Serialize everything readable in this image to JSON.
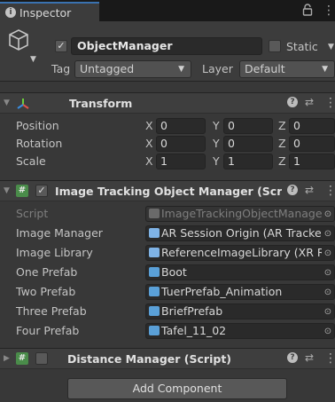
{
  "tab": {
    "title": "Inspector",
    "icon": "info-icon"
  },
  "object": {
    "name": "ObjectManager",
    "active_checked": true,
    "static_label": "Static",
    "static_checked": false,
    "tag_label": "Tag",
    "tag_value": "Untagged",
    "layer_label": "Layer",
    "layer_value": "Default"
  },
  "transform": {
    "title": "Transform",
    "rows": [
      {
        "label": "Position",
        "x": "0",
        "y": "0",
        "z": "0"
      },
      {
        "label": "Rotation",
        "x": "0",
        "y": "0",
        "z": "0"
      },
      {
        "label": "Scale",
        "x": "1",
        "y": "1",
        "z": "1"
      }
    ],
    "axis": {
      "x": "X",
      "y": "Y",
      "z": "Z"
    }
  },
  "image_tracking": {
    "title": "Image Tracking Object Manager (Scri",
    "enabled": true,
    "rows": [
      {
        "label": "Script",
        "value": "ImageTrackingObjectManage",
        "icon": "script-icon",
        "disabled": true
      },
      {
        "label": "Image Manager",
        "value": "AR Session Origin (AR Tracke",
        "icon": "component-icon"
      },
      {
        "label": "Image Library",
        "value": "ReferenceImageLibrary (XR R",
        "icon": "component-icon"
      },
      {
        "label": "One Prefab",
        "value": "Boot",
        "icon": "prefab-icon"
      },
      {
        "label": "Two Prefab",
        "value": "TuerPrefab_Animation",
        "icon": "prefab-icon"
      },
      {
        "label": "Three Prefab",
        "value": "BriefPrefab",
        "icon": "prefab-icon"
      },
      {
        "label": "Four Prefab",
        "value": "Tafel_11_02",
        "icon": "prefab-icon"
      }
    ]
  },
  "distance_manager": {
    "title": "Distance Manager (Script)",
    "enabled": false
  },
  "add_component_label": "Add Component",
  "colors": {
    "accent": "#3a72b0",
    "prefab": "#5aa0d8",
    "script_green": "#4a8c4a"
  }
}
